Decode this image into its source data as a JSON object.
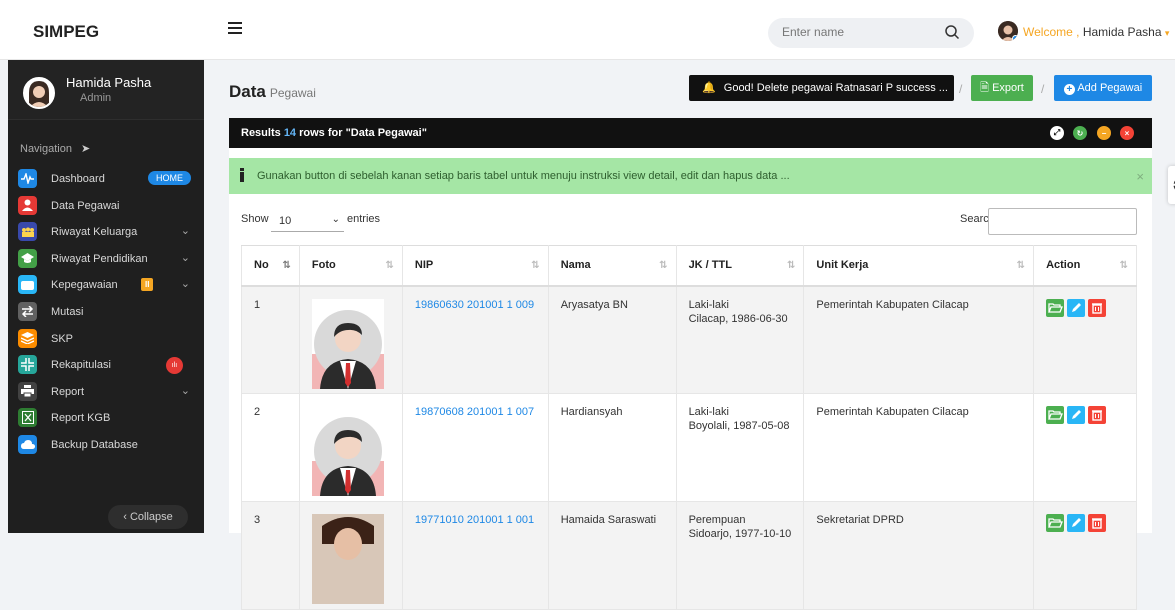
{
  "app": {
    "brand": "SIMPEG"
  },
  "header": {
    "search_placeholder": "Enter name",
    "welcome_prefix": "Welcome ,",
    "welcome_name": "Hamida Pasha",
    "caret": "▾"
  },
  "sidebar": {
    "profile_name": "Hamida Pasha",
    "profile_role": "Admin",
    "nav_heading": "Navigation",
    "items": [
      {
        "label": "Dashboard",
        "icon": "pulse-icon",
        "color": "#1e88e5",
        "badge": "HOME"
      },
      {
        "label": "Data Pegawai",
        "icon": "user-icon",
        "color": "#e53935"
      },
      {
        "label": "Riwayat Keluarga",
        "icon": "family-icon",
        "color": "#3949ab",
        "chevron": true
      },
      {
        "label": "Riwayat Pendidikan",
        "icon": "education-icon",
        "color": "#43a047",
        "chevron": true
      },
      {
        "label": "Kepegawaian",
        "icon": "briefcase-icon",
        "color": "#29b6f6",
        "chevron": true,
        "badge": "II"
      },
      {
        "label": "Mutasi",
        "icon": "swap-icon",
        "color": "#616161"
      },
      {
        "label": "SKP",
        "icon": "layers-icon",
        "color": "#fb8c00"
      },
      {
        "label": "Rekapitulasi",
        "icon": "compress-icon",
        "color": "#26a69a",
        "badge": "ılı"
      },
      {
        "label": "Report",
        "icon": "print-icon",
        "color": "#424242",
        "chevron": true
      },
      {
        "label": "Report KGB",
        "icon": "excel-icon",
        "color": "#2e7d32"
      },
      {
        "label": "Backup Database",
        "icon": "cloud-icon",
        "color": "#1e88e5"
      }
    ],
    "collapse_label": "Collapse"
  },
  "main": {
    "title": "Data",
    "subtitle": "Pegawai",
    "notification": "Good! Delete pegawai Ratnasari P success ...",
    "export_label": "Export",
    "add_label": "Add Pegawai",
    "separator": "/"
  },
  "panel": {
    "header_prefix": "Results",
    "row_count": "14",
    "header_suffix": "rows for \"Data Pegawai\"",
    "alert": "Gunakan button di sebelah kanan setiap baris tabel untuk menuju instruksi view detail, edit dan hapus data ...",
    "show_label": "Show",
    "page_size": "10",
    "entries_label": "entries",
    "search_label": "Search:",
    "columns": [
      "No",
      "Foto",
      "NIP",
      "Nama",
      "JK / TTL",
      "Unit Kerja",
      "Action"
    ],
    "rows": [
      {
        "no": "1",
        "nip": "19860630 201001 1 009",
        "nama": "Aryasatya BN",
        "jk": "Laki-laki",
        "ttl": "Cilacap, 1986-06-30",
        "unit": "Pemerintah Kabupaten Cilacap"
      },
      {
        "no": "2",
        "nip": "19870608 201001 1 007",
        "nama": "Hardiansyah",
        "jk": "Laki-laki",
        "ttl": "Boyolali, 1987-05-08",
        "unit": "Pemerintah Kabupaten Cilacap"
      },
      {
        "no": "3",
        "nip": "19771010 201001 1 001",
        "nama": "Hamaida Saraswati",
        "jk": "Perempuan",
        "ttl": "Sidoarjo, 1977-10-10",
        "unit": "Sekretariat DPRD"
      }
    ]
  }
}
